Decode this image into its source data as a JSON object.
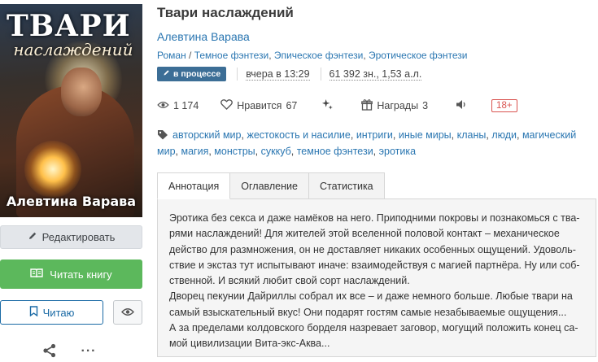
{
  "cover": {
    "title_main": "ТВАРИ",
    "title_sub": "наслаждений",
    "author": "Алевтина Варава"
  },
  "left_actions": {
    "edit_label": "Редактировать",
    "read_label": "Читать книгу",
    "reading_label": "Читаю"
  },
  "book": {
    "title": "Твари наслаждений",
    "author": "Алевтина Варава",
    "genres": [
      {
        "label": "Роман",
        "sep": " / "
      },
      {
        "label": "Темное фэнтези",
        "sep": ", "
      },
      {
        "label": "Эпическое фэнтези",
        "sep": ", "
      },
      {
        "label": "Эротическое фэнтези",
        "sep": ""
      }
    ],
    "status_badge": "в процессе",
    "updated": "вчера в 13:29",
    "size": "61 392 зн., 1,53 а.л."
  },
  "stats": {
    "views": "1 174",
    "likes_label": "Нравится",
    "likes": "67",
    "awards_label": "Награды",
    "awards": "3",
    "age_rating": "18+"
  },
  "tags": [
    "авторский мир",
    "жестокость и насилие",
    "интриги",
    "иные миры",
    "кланы",
    "люди",
    "магический мир",
    "магия",
    "монстры",
    "суккуб",
    "темное фэнтези",
    "эротика"
  ],
  "tabs": [
    {
      "label": "Аннотация",
      "active": true
    },
    {
      "label": "Оглавление",
      "active": false
    },
    {
      "label": "Статистика",
      "active": false
    }
  ],
  "annotation": {
    "lines": [
      "Эротика без секса и даже намёков на него. Приподними покровы и познакомься с тва-",
      "рями наслаждений! Для жителей этой вселенной половой контакт – механическое",
      "действо для размножения, он не доставляет никаких особенных ощущений. Удоволь-",
      "ствие и экстаз тут испытывают иначе: взаимодействуя с магией партнёра. Ну или соб-",
      "ственной. И всякий любит свой сорт наслаждений.",
      "Дворец пекунии Дайриллы собрал их все – и даже немного больше. Любые твари на",
      "самый взыскательный вкус! Они подарят гостям самые незабываемые ощущения...",
      "А за пределами колдовского борделя назревает заговор, могущий положить конец са-",
      "мой цивилизации Вита-экс-Аква..."
    ]
  },
  "colors": {
    "link": "#2a76b1",
    "badge": "#3c6e96",
    "read_button": "#5cb85c",
    "age_rating": "#d9534f"
  },
  "icons": {
    "edit": "pencil-icon",
    "read": "open-book-icon",
    "reading": "bookmark-icon",
    "eye": "eye-icon",
    "share": "share-icon",
    "more": "more-dots-icon",
    "views": "eye-icon",
    "likes": "heart-icon",
    "sparkle": "sparkle-icon",
    "awards": "gift-icon",
    "audio": "speaker-icon",
    "tags": "tag-icon"
  }
}
